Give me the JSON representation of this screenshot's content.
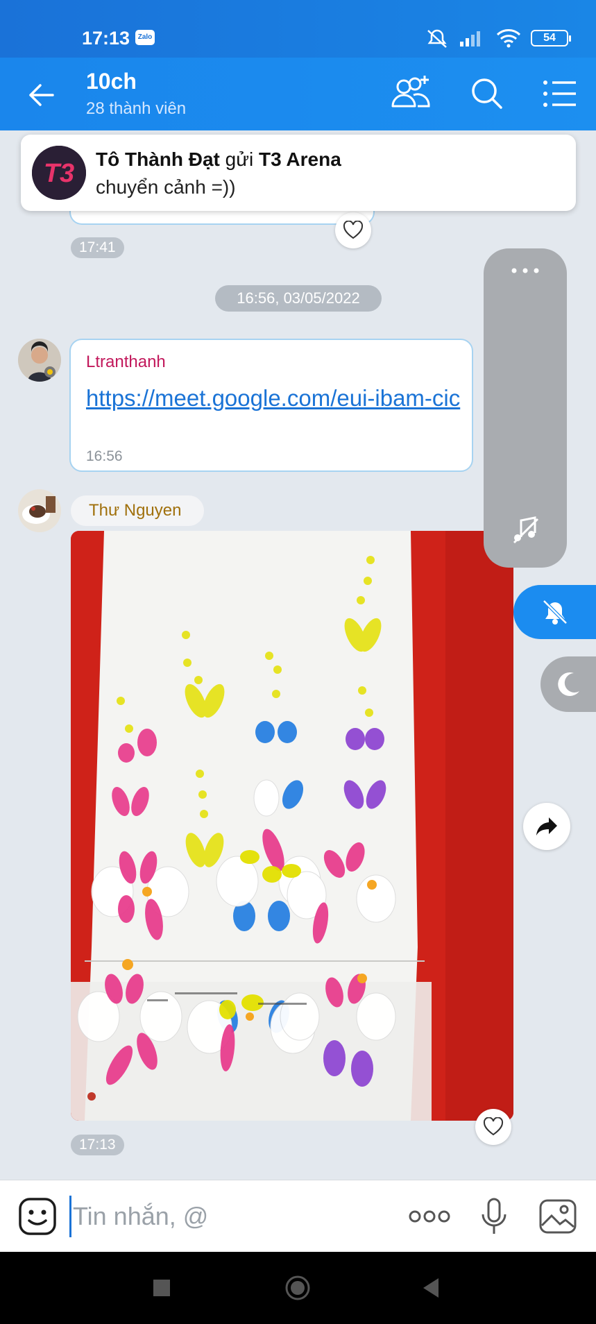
{
  "status": {
    "time": "17:13",
    "app_badge": "Zalo",
    "battery": "54"
  },
  "header": {
    "title": "10ch",
    "subtitle": "28 thành viên"
  },
  "notification": {
    "logo_text": "T3",
    "sender": "Tô Thành Đạt",
    "verb": " gửi ",
    "target": "T3 Arena",
    "message": "chuyển cảnh =))"
  },
  "messages": {
    "prev_time": "17:41",
    "date_separator": "16:56, 03/05/2022",
    "link_msg": {
      "sender": "Ltranthanh",
      "link": "https://meet.google.com/eui-ibam-cic",
      "time": "16:56"
    },
    "photo_msg": {
      "sender": "Thư Nguyen",
      "time": "17:13"
    }
  },
  "input": {
    "placeholder": "Tin nhắn, @"
  },
  "colors": {
    "header": "#1a86ec",
    "accent": "#1b8cf0",
    "link": "#1a73d6",
    "sender_pink": "#c2185b",
    "sender_gold": "#a0700c"
  },
  "icons": [
    "back-arrow-icon",
    "add-member-icon",
    "search-icon",
    "menu-list-icon",
    "heart-icon",
    "more-dots-icon",
    "music-off-icon",
    "bell-off-icon",
    "moon-icon",
    "share-icon",
    "sticker-icon",
    "more-icon",
    "mic-icon",
    "image-icon",
    "recent-apps-icon",
    "home-icon",
    "back-nav-icon"
  ]
}
